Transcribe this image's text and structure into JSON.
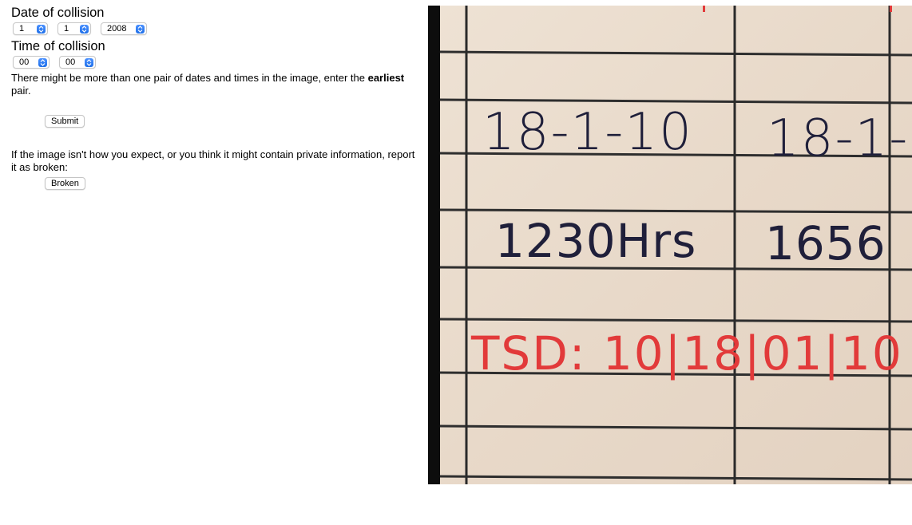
{
  "form": {
    "date_heading": "Date of collision",
    "date": {
      "day": "1",
      "month": "1",
      "year": "2008"
    },
    "time_heading": "Time of collision",
    "time": {
      "hour": "00",
      "minute": "00"
    },
    "instructions_pre": "There might be more than one pair of dates and times in the image, enter the ",
    "instructions_bold": "earliest",
    "instructions_post": " pair.",
    "submit_label": "Submit",
    "broken_text": "If the image isn't how you expect, or you think it might contain private information, report it as broken:",
    "broken_label": "Broken"
  },
  "image": {
    "row1_left": "18-1-10",
    "row1_right": "18-1-",
    "row2_left": "1230Hrs",
    "row2_right": "1656",
    "row3": "TSD: 10|18|01|10",
    "ink_dark": "#1f1f3a",
    "ink_red": "#e23a3a",
    "paper": "#e9dccd",
    "lines": "#2e2e2e"
  },
  "colors": {
    "select_arrow": "#1f6fe8"
  }
}
